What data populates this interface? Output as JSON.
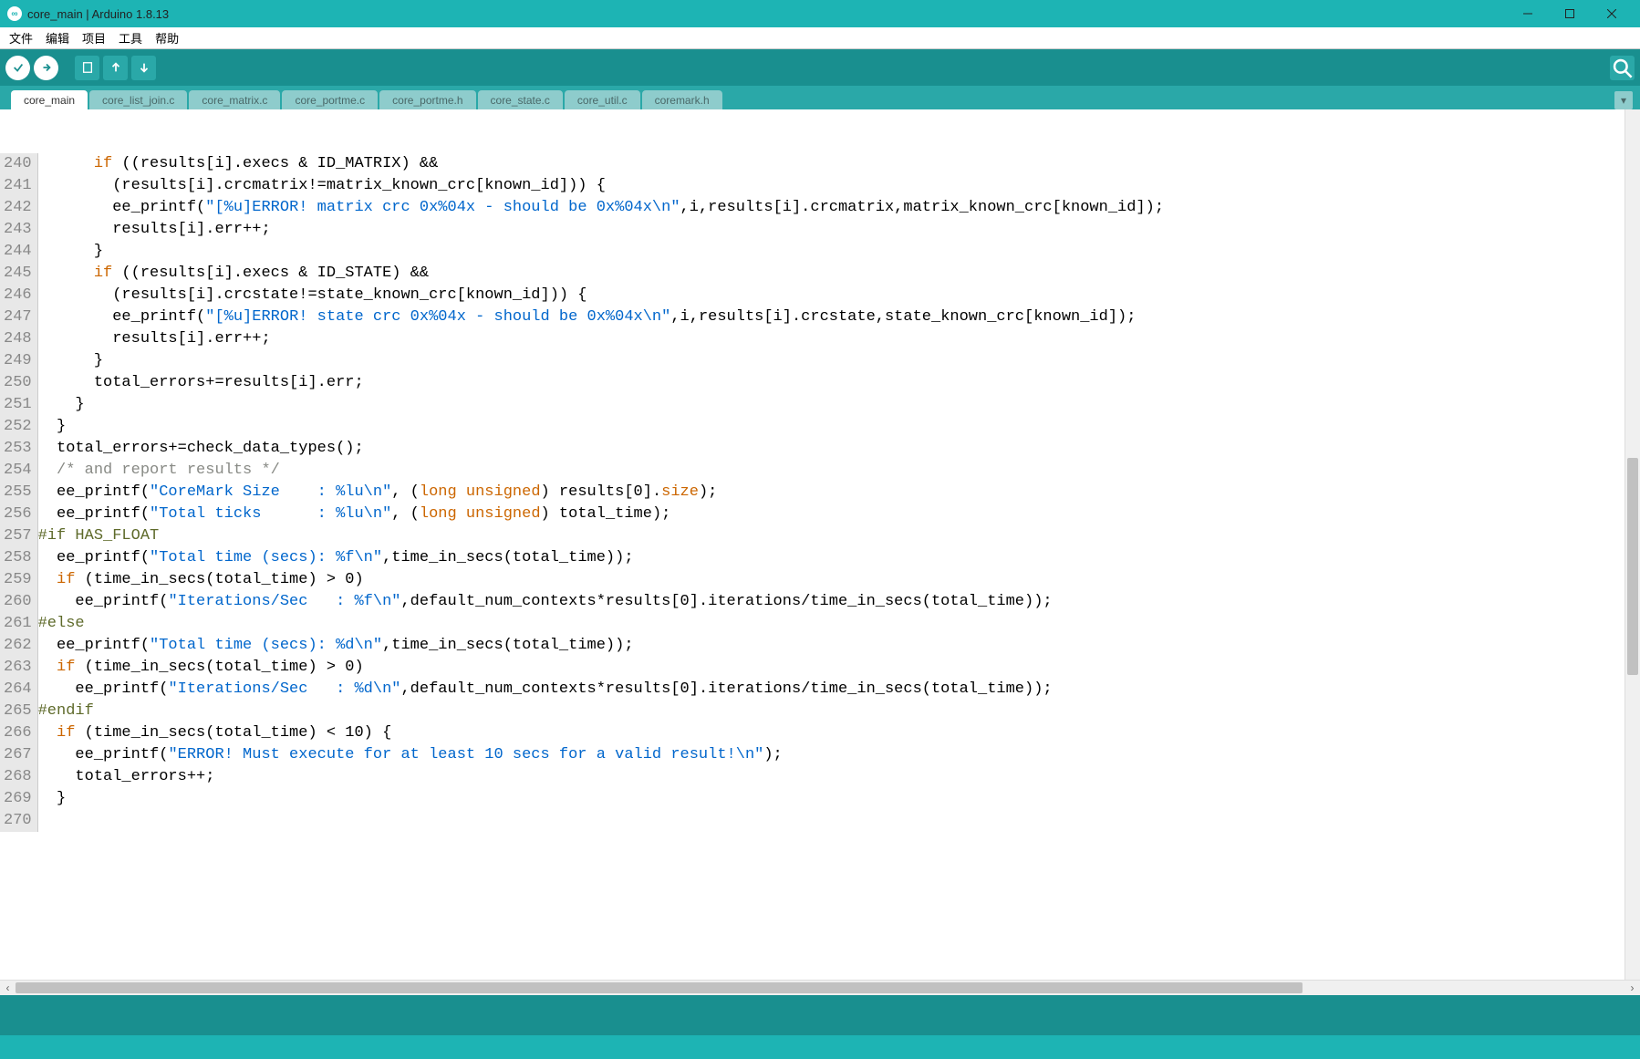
{
  "window": {
    "title": "core_main | Arduino 1.8.13"
  },
  "menu": {
    "file": "文件",
    "edit": "编辑",
    "project": "项目",
    "tools": "工具",
    "help": "帮助"
  },
  "tabs": [
    {
      "label": "core_main",
      "active": true
    },
    {
      "label": "core_list_join.c",
      "active": false
    },
    {
      "label": "core_matrix.c",
      "active": false
    },
    {
      "label": "core_portme.c",
      "active": false
    },
    {
      "label": "core_portme.h",
      "active": false
    },
    {
      "label": "core_state.c",
      "active": false
    },
    {
      "label": "core_util.c",
      "active": false
    },
    {
      "label": "coremark.h",
      "active": false
    }
  ],
  "editor": {
    "first_line": 240,
    "lines": [
      {
        "n": 240,
        "seg": [
          {
            "t": "      "
          },
          {
            "t": "if",
            "c": "kw"
          },
          {
            "t": " ((results[i].execs & ID_MATRIX) &&"
          }
        ]
      },
      {
        "n": 241,
        "seg": [
          {
            "t": "        (results[i].crcmatrix!=matrix_known_crc[known_id])) {"
          }
        ]
      },
      {
        "n": 242,
        "seg": [
          {
            "t": "        ee_printf("
          },
          {
            "t": "\"[%u]ERROR! matrix crc 0x%04x - should be 0x%04x\\n\"",
            "c": "str"
          },
          {
            "t": ",i,results[i].crcmatrix,matrix_known_crc[known_id]);"
          }
        ]
      },
      {
        "n": 243,
        "seg": [
          {
            "t": "        results[i].err++;"
          }
        ]
      },
      {
        "n": 244,
        "seg": [
          {
            "t": "      }"
          }
        ]
      },
      {
        "n": 245,
        "seg": [
          {
            "t": "      "
          },
          {
            "t": "if",
            "c": "kw"
          },
          {
            "t": " ((results[i].execs & ID_STATE) &&"
          }
        ]
      },
      {
        "n": 246,
        "seg": [
          {
            "t": "        (results[i].crcstate!=state_known_crc[known_id])) {"
          }
        ]
      },
      {
        "n": 247,
        "seg": [
          {
            "t": "        ee_printf("
          },
          {
            "t": "\"[%u]ERROR! state crc 0x%04x - should be 0x%04x\\n\"",
            "c": "str"
          },
          {
            "t": ",i,results[i].crcstate,state_known_crc[known_id]);"
          }
        ]
      },
      {
        "n": 248,
        "seg": [
          {
            "t": "        results[i].err++;"
          }
        ]
      },
      {
        "n": 249,
        "seg": [
          {
            "t": "      }"
          }
        ]
      },
      {
        "n": 250,
        "seg": [
          {
            "t": "      total_errors+=results[i].err;"
          }
        ]
      },
      {
        "n": 251,
        "seg": [
          {
            "t": "    }"
          }
        ]
      },
      {
        "n": 252,
        "seg": [
          {
            "t": "  }"
          }
        ]
      },
      {
        "n": 253,
        "seg": [
          {
            "t": "  total_errors+=check_data_types();"
          }
        ]
      },
      {
        "n": 254,
        "seg": [
          {
            "t": "  "
          },
          {
            "t": "/* and report results */",
            "c": "cmt"
          }
        ]
      },
      {
        "n": 255,
        "seg": [
          {
            "t": "  ee_printf("
          },
          {
            "t": "\"CoreMark Size    : %lu\\n\"",
            "c": "str"
          },
          {
            "t": ", ("
          },
          {
            "t": "long",
            "c": "kw"
          },
          {
            "t": " "
          },
          {
            "t": "unsigned",
            "c": "kw"
          },
          {
            "t": ") results[0]."
          },
          {
            "t": "size",
            "c": "kw"
          },
          {
            "t": ");"
          }
        ]
      },
      {
        "n": 256,
        "seg": [
          {
            "t": "  ee_printf("
          },
          {
            "t": "\"Total ticks      : %lu\\n\"",
            "c": "str"
          },
          {
            "t": ", ("
          },
          {
            "t": "long",
            "c": "kw"
          },
          {
            "t": " "
          },
          {
            "t": "unsigned",
            "c": "kw"
          },
          {
            "t": ") total_time);"
          }
        ]
      },
      {
        "n": 257,
        "seg": [
          {
            "t": "#if HAS_FLOAT",
            "c": "pp"
          }
        ]
      },
      {
        "n": 258,
        "seg": [
          {
            "t": "  ee_printf("
          },
          {
            "t": "\"Total time (secs): %f\\n\"",
            "c": "str"
          },
          {
            "t": ",time_in_secs(total_time));"
          }
        ]
      },
      {
        "n": 259,
        "seg": [
          {
            "t": "  "
          },
          {
            "t": "if",
            "c": "kw"
          },
          {
            "t": " (time_in_secs(total_time) > 0)"
          }
        ]
      },
      {
        "n": 260,
        "seg": [
          {
            "t": "    ee_printf("
          },
          {
            "t": "\"Iterations/Sec   : %f\\n\"",
            "c": "str"
          },
          {
            "t": ",default_num_contexts*results[0].iterations/time_in_secs(total_time));"
          }
        ]
      },
      {
        "n": 261,
        "seg": [
          {
            "t": "#else",
            "c": "pp"
          }
        ]
      },
      {
        "n": 262,
        "seg": [
          {
            "t": "  ee_printf("
          },
          {
            "t": "\"Total time (secs): %d\\n\"",
            "c": "str"
          },
          {
            "t": ",time_in_secs(total_time));"
          }
        ]
      },
      {
        "n": 263,
        "seg": [
          {
            "t": "  "
          },
          {
            "t": "if",
            "c": "kw"
          },
          {
            "t": " (time_in_secs(total_time) > 0)"
          }
        ]
      },
      {
        "n": 264,
        "seg": [
          {
            "t": "    ee_printf("
          },
          {
            "t": "\"Iterations/Sec   : %d\\n\"",
            "c": "str"
          },
          {
            "t": ",default_num_contexts*results[0].iterations/time_in_secs(total_time));"
          }
        ]
      },
      {
        "n": 265,
        "seg": [
          {
            "t": "#endif",
            "c": "pp"
          }
        ]
      },
      {
        "n": 266,
        "seg": [
          {
            "t": "  "
          },
          {
            "t": "if",
            "c": "kw"
          },
          {
            "t": " (time_in_secs(total_time) < 10) {"
          }
        ]
      },
      {
        "n": 267,
        "seg": [
          {
            "t": "    ee_printf("
          },
          {
            "t": "\"ERROR! Must execute for at least 10 secs for a valid result!\\n\"",
            "c": "str"
          },
          {
            "t": ");"
          }
        ]
      },
      {
        "n": 268,
        "seg": [
          {
            "t": "    total_errors++;"
          }
        ]
      },
      {
        "n": 269,
        "seg": [
          {
            "t": "  }"
          }
        ]
      },
      {
        "n": 270,
        "seg": [
          {
            "t": ""
          }
        ]
      }
    ]
  }
}
